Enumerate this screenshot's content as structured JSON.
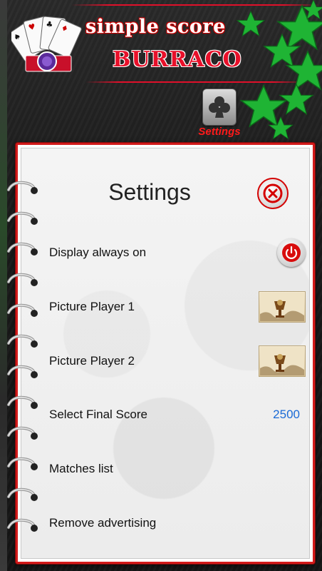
{
  "header": {
    "title_line1": "simple score",
    "title_line2": "BURRACO",
    "settings_icon": "club-card-icon",
    "settings_label": "Settings"
  },
  "panel": {
    "title": "Settings",
    "close_icon": "close-icon",
    "rows": [
      {
        "label": "Display always on",
        "control": "power-toggle-icon"
      },
      {
        "label": "Picture Player 1",
        "control": "player-picture-thumbnail"
      },
      {
        "label": "Picture Player 2",
        "control": "player-picture-thumbnail"
      },
      {
        "label": "Select Final Score",
        "value": "2500"
      },
      {
        "label": "Matches list"
      },
      {
        "label": "Remove advertising"
      }
    ]
  },
  "colors": {
    "accent_red": "#e0102a",
    "value_blue": "#1a6ad6",
    "star_green": "#22c43a"
  }
}
